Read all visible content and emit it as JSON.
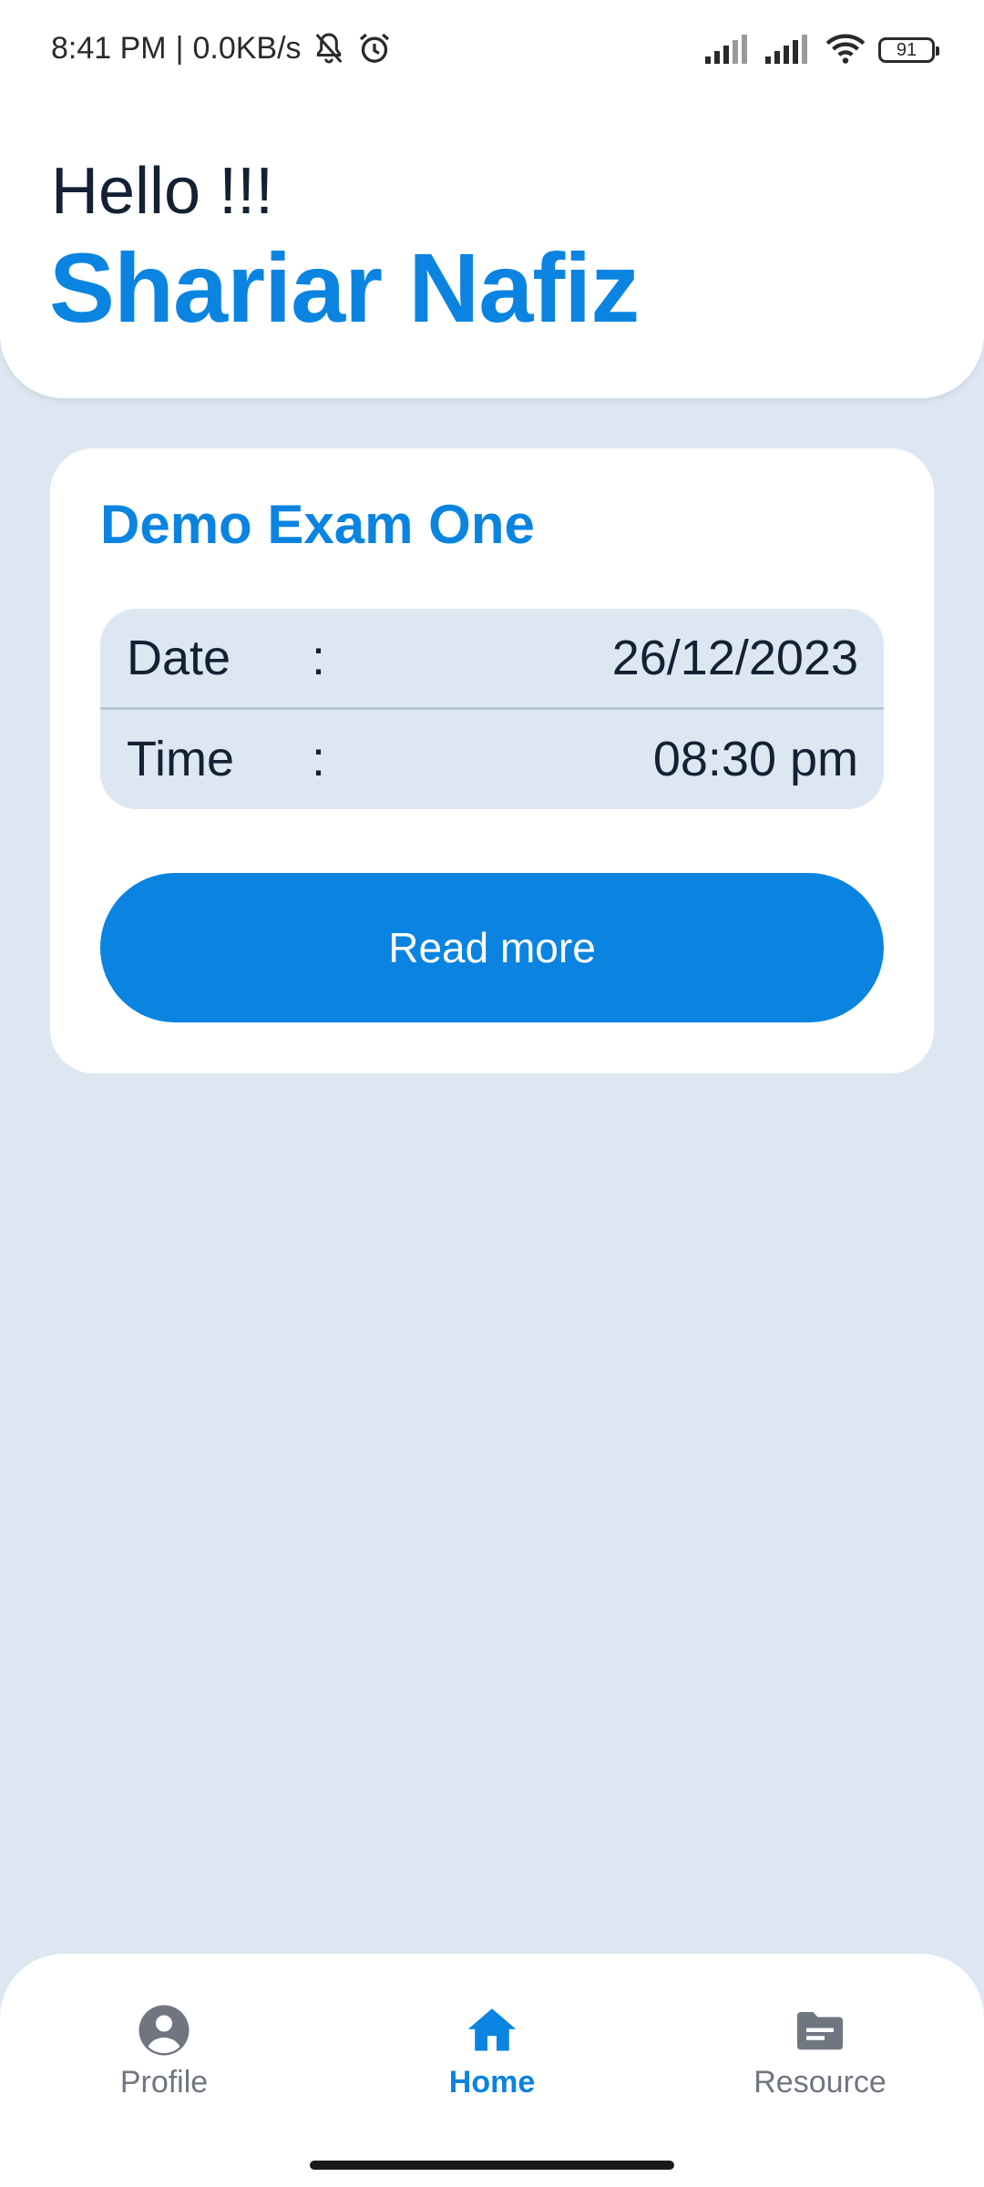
{
  "status_bar": {
    "time": "8:41 PM",
    "separator": "|",
    "network_speed": "0.0KB/s",
    "battery": "91",
    "icons": [
      "muted-bell-icon",
      "alarm-icon",
      "signal-icon",
      "signal-icon",
      "wifi-icon",
      "battery-icon"
    ]
  },
  "header": {
    "greeting": "Hello !!!",
    "user_name": "Shariar Nafiz"
  },
  "exam_card": {
    "title": "Demo Exam One",
    "rows": [
      {
        "label": "Date",
        "colon": ":",
        "value": "26/12/2023"
      },
      {
        "label": "Time",
        "colon": ":",
        "value": "08:30 pm"
      }
    ],
    "button_label": "Read more"
  },
  "bottom_nav": {
    "items": [
      {
        "label": "Profile",
        "icon": "account-circle-icon",
        "active": false
      },
      {
        "label": "Home",
        "icon": "home-icon",
        "active": true
      },
      {
        "label": "Resource",
        "icon": "folder-icon",
        "active": false
      }
    ]
  },
  "colors": {
    "accent": "#0a84e0",
    "background": "#dce7f1",
    "text_dark": "#142033",
    "nav_inactive": "#707680"
  }
}
